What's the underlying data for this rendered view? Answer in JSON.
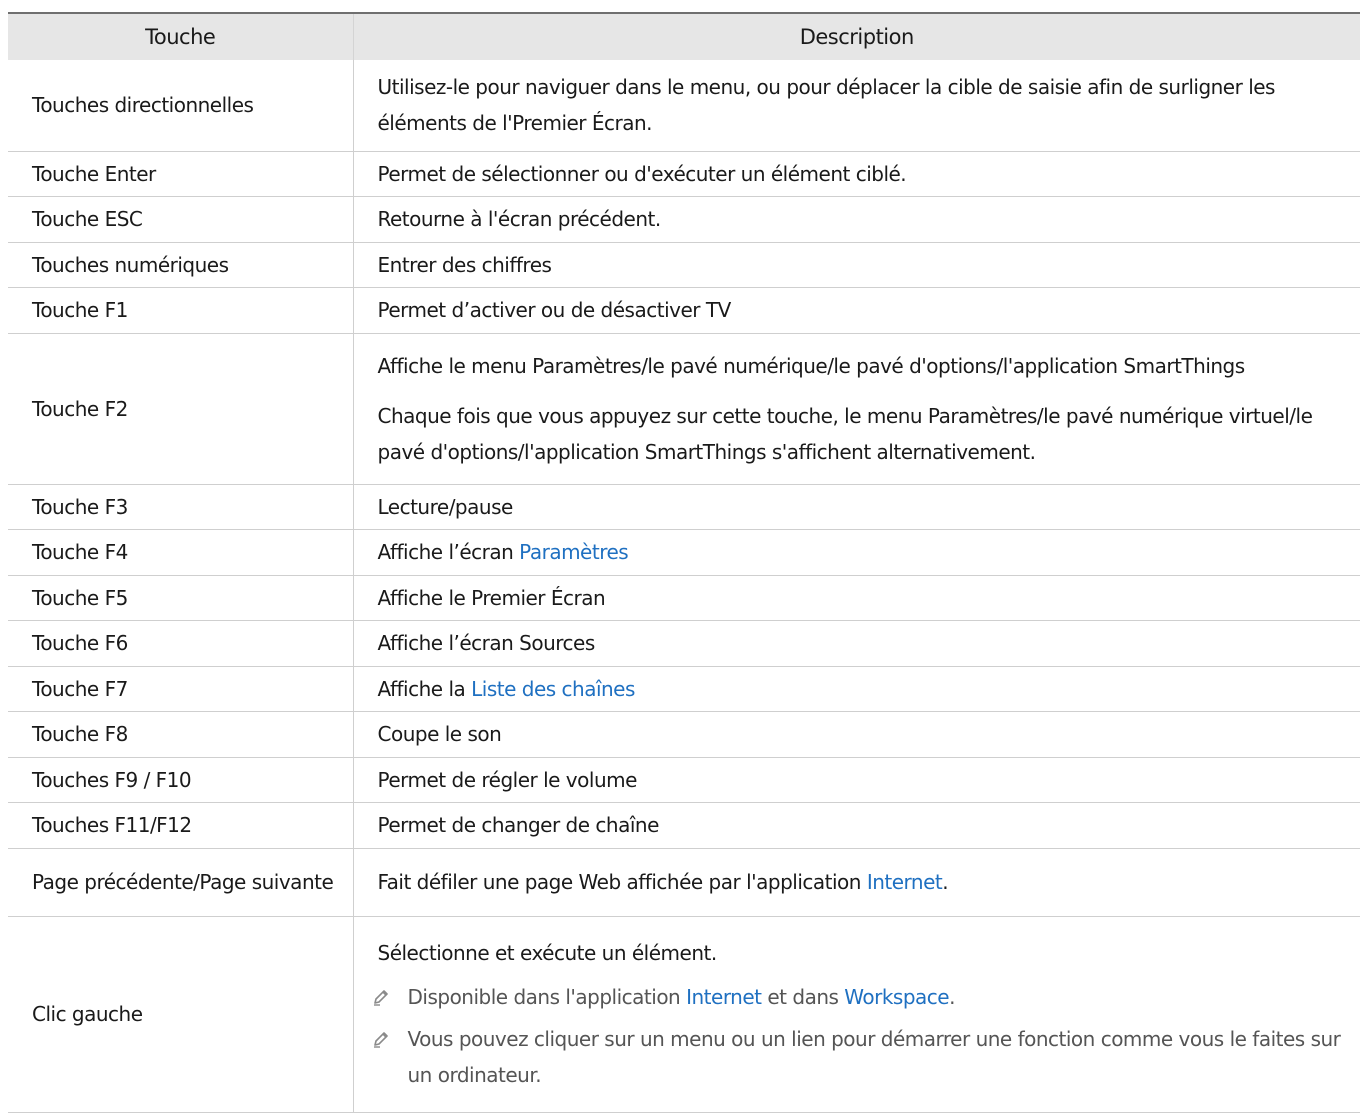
{
  "header": {
    "col_key": "Touche",
    "col_desc": "Description"
  },
  "rows": [
    {
      "key": "Touches directionnelles",
      "desc": "Utilisez-le pour naviguer dans le menu, ou pour déplacer la cible de saisie afin de surligner les éléments de l'Premier Écran."
    },
    {
      "key": "Touche Enter",
      "desc": "Permet de sélectionner ou d'exécuter un élément ciblé."
    },
    {
      "key": "Touche ESC",
      "desc": "Retourne à l'écran précédent."
    },
    {
      "key": "Touches numériques",
      "desc": "Entrer des chiffres"
    },
    {
      "key": "Touche F1",
      "desc": "Permet d’activer ou de désactiver TV"
    },
    {
      "key": "Touche F2",
      "desc_1": "Affiche le menu Paramètres/le pavé numérique/le pavé d'options/l'application SmartThings",
      "desc_2": "Chaque fois que vous appuyez sur cette touche, le menu Paramètres/le pavé numérique virtuel/le pavé d'options/l'application SmartThings s'affichent alternativement."
    },
    {
      "key": "Touche F3",
      "desc": "Lecture/pause"
    },
    {
      "key": "Touche F4",
      "desc_prefix": "Affiche l’écran ",
      "desc_link": "Paramètres"
    },
    {
      "key": "Touche F5",
      "desc": "Affiche le Premier Écran"
    },
    {
      "key": "Touche F6",
      "desc": "Affiche l’écran Sources"
    },
    {
      "key": "Touche F7",
      "desc_prefix": "Affiche la ",
      "desc_link": "Liste des chaînes"
    },
    {
      "key": "Touche F8",
      "desc": "Coupe le son"
    },
    {
      "key": "Touches F9 / F10",
      "desc": "Permet de régler le volume"
    },
    {
      "key": "Touches F11/F12",
      "desc": "Permet de changer de chaîne"
    },
    {
      "key": "Page précédente/Page suivante",
      "desc_prefix": "Fait défiler une page Web affichée par l'application ",
      "desc_link": "Internet",
      "desc_suffix": "."
    },
    {
      "key": "Clic gauche",
      "desc": "Sélectionne et exécute un élément.",
      "note1_prefix": "Disponible dans l'application ",
      "note1_link1": "Internet",
      "note1_mid": " et dans ",
      "note1_link2": "Workspace",
      "note1_suffix": ".",
      "note2": "Vous pouvez cliquer sur un menu ou un lien pour démarrer une fonction comme vous le faites sur un ordinateur."
    }
  ],
  "colors": {
    "link": "#1f70c1",
    "header_bg": "#e6e6e6",
    "note_text": "#555555"
  },
  "icons": {
    "note": "pencil-icon"
  }
}
